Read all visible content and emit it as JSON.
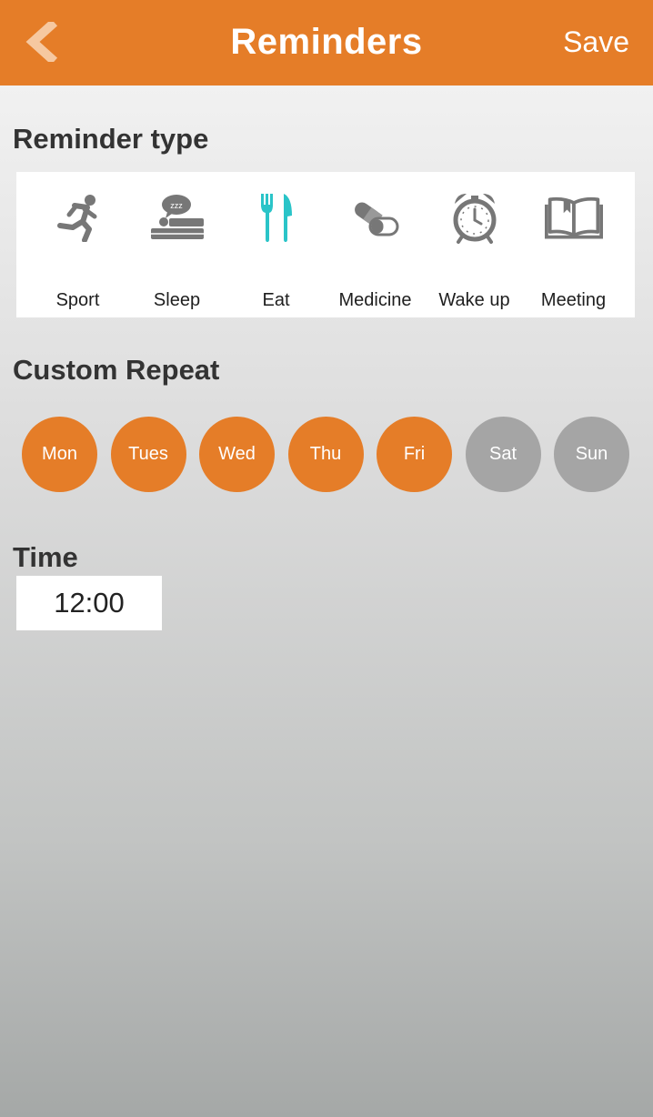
{
  "colors": {
    "accent": "#e57d28",
    "eat_selected": "#2ac4c8",
    "icon_gray": "#777777",
    "day_active": "#e57d28",
    "day_inactive": "#a5a5a5"
  },
  "header": {
    "back_icon": "chevron-left-icon",
    "title": "Reminders",
    "save_label": "Save"
  },
  "reminder_type": {
    "heading": "Reminder type",
    "items": [
      {
        "label": "Sport",
        "icon": "running-person-icon",
        "selected": false
      },
      {
        "label": "Sleep",
        "icon": "sleep-bed-icon",
        "selected": false
      },
      {
        "label": "Eat",
        "icon": "fork-knife-icon",
        "selected": true
      },
      {
        "label": "Medicine",
        "icon": "pill-capsule-icon",
        "selected": false
      },
      {
        "label": "Wake up",
        "icon": "alarm-clock-icon",
        "selected": false
      },
      {
        "label": "Meeting",
        "icon": "open-book-icon",
        "selected": false
      }
    ]
  },
  "custom_repeat": {
    "heading": "Custom Repeat",
    "days": [
      {
        "label": "Mon",
        "active": true
      },
      {
        "label": "Tues",
        "active": true
      },
      {
        "label": "Wed",
        "active": true
      },
      {
        "label": "Thu",
        "active": true
      },
      {
        "label": "Fri",
        "active": true
      },
      {
        "label": "Sat",
        "active": false
      },
      {
        "label": "Sun",
        "active": false
      }
    ]
  },
  "time": {
    "heading": "Time",
    "value": "12:00"
  }
}
